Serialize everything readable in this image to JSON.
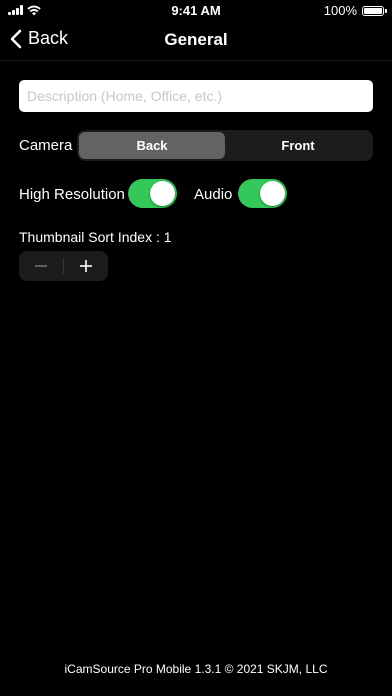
{
  "status_bar": {
    "time": "9:41 AM",
    "battery": "100%"
  },
  "nav": {
    "back_label": "Back",
    "title": "General"
  },
  "description": {
    "placeholder": "Description (Home, Office, etc.)",
    "value": ""
  },
  "camera": {
    "label": "Camera",
    "options": [
      "Back",
      "Front"
    ],
    "selected": "Back"
  },
  "high_resolution": {
    "label": "High Resolution",
    "on": true
  },
  "audio": {
    "label": "Audio",
    "on": true
  },
  "thumbnail": {
    "label": "Thumbnail Sort Index : 1"
  },
  "footer": {
    "text": "iCamSource Pro Mobile 1.3.1 © 2021 SKJM, LLC"
  },
  "colors": {
    "toggle_on": "#34c759",
    "segment_active": "#636366",
    "background": "#000000"
  }
}
